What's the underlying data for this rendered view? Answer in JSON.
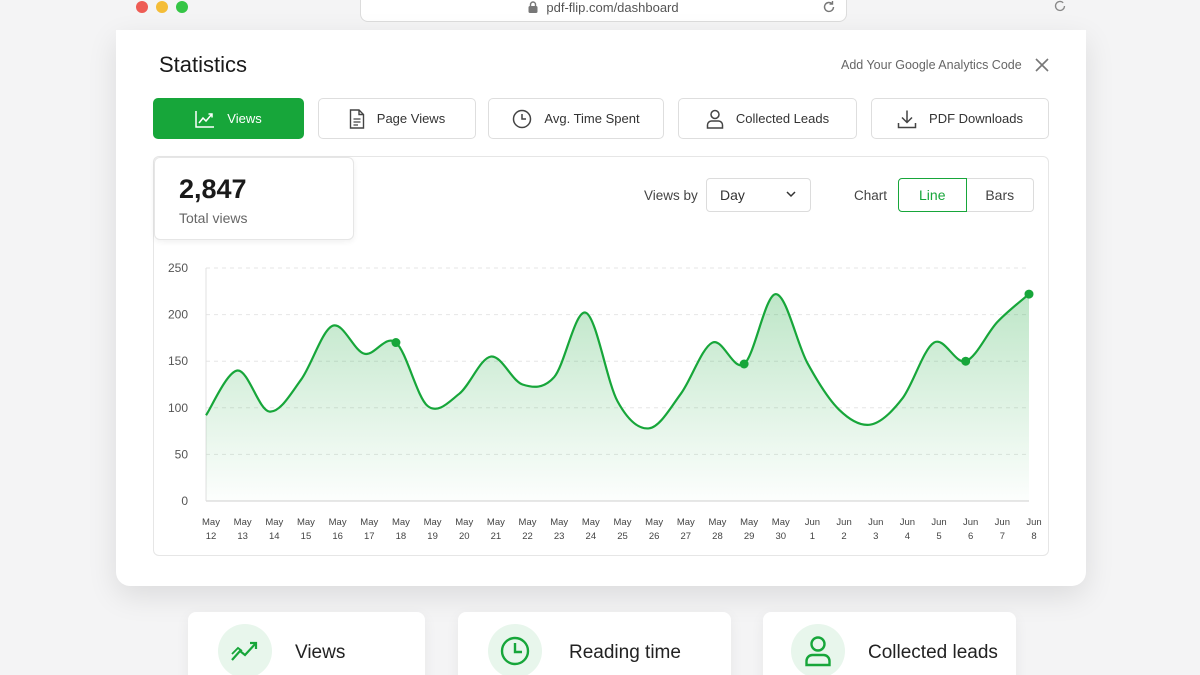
{
  "browser": {
    "url": "pdf-flip.com/dashboard"
  },
  "header": {
    "title": "Statistics",
    "ga_link": "Add Your Google Analytics Code"
  },
  "tabs": [
    {
      "label": "Views",
      "icon": "trend-line-icon",
      "active": true
    },
    {
      "label": "Page Views",
      "icon": "document-icon",
      "active": false
    },
    {
      "label": "Avg. Time Spent",
      "icon": "clock-icon",
      "active": false
    },
    {
      "label": "Collected Leads",
      "icon": "user-icon",
      "active": false
    },
    {
      "label": "PDF Downloads",
      "icon": "download-icon",
      "active": false
    }
  ],
  "summary": {
    "value": "2,847",
    "label": "Total views"
  },
  "controls": {
    "views_by_label": "Views by",
    "views_by_value": "Day",
    "chart_label": "Chart",
    "chart_options": [
      "Line",
      "Bars"
    ],
    "chart_selected": "Line"
  },
  "colors": {
    "accent": "#17a63a",
    "accent_light": "#e8f6ec"
  },
  "chart_data": {
    "type": "line",
    "categories": [
      "May 12",
      "May 13",
      "May 14",
      "May 15",
      "May 16",
      "May 17",
      "May 18",
      "May 19",
      "May 20",
      "May 21",
      "May 22",
      "May 23",
      "May 24",
      "May 25",
      "May 26",
      "May 27",
      "May 28",
      "May 29",
      "May 30",
      "Jun 1",
      "Jun 2",
      "Jun 3",
      "Jun 4",
      "Jun 5",
      "Jun 6",
      "Jun 7",
      "Jun 8"
    ],
    "values": [
      92,
      140,
      96,
      130,
      188,
      158,
      170,
      102,
      115,
      155,
      125,
      133,
      202,
      107,
      78,
      115,
      170,
      147,
      222,
      148,
      98,
      82,
      110,
      170,
      150,
      192,
      222
    ],
    "highlight_points": [
      "May 18",
      "May 29",
      "Jun 6",
      "Jun 8"
    ],
    "ylim": [
      0,
      250
    ],
    "yticks": [
      0,
      50,
      100,
      150,
      200,
      250
    ],
    "grid": true,
    "area_fill": true
  },
  "features": [
    {
      "label": "Views",
      "icon": "trend-up-icon"
    },
    {
      "label": "Reading time",
      "icon": "clock-icon"
    },
    {
      "label": "Collected leads",
      "icon": "user-icon"
    }
  ]
}
